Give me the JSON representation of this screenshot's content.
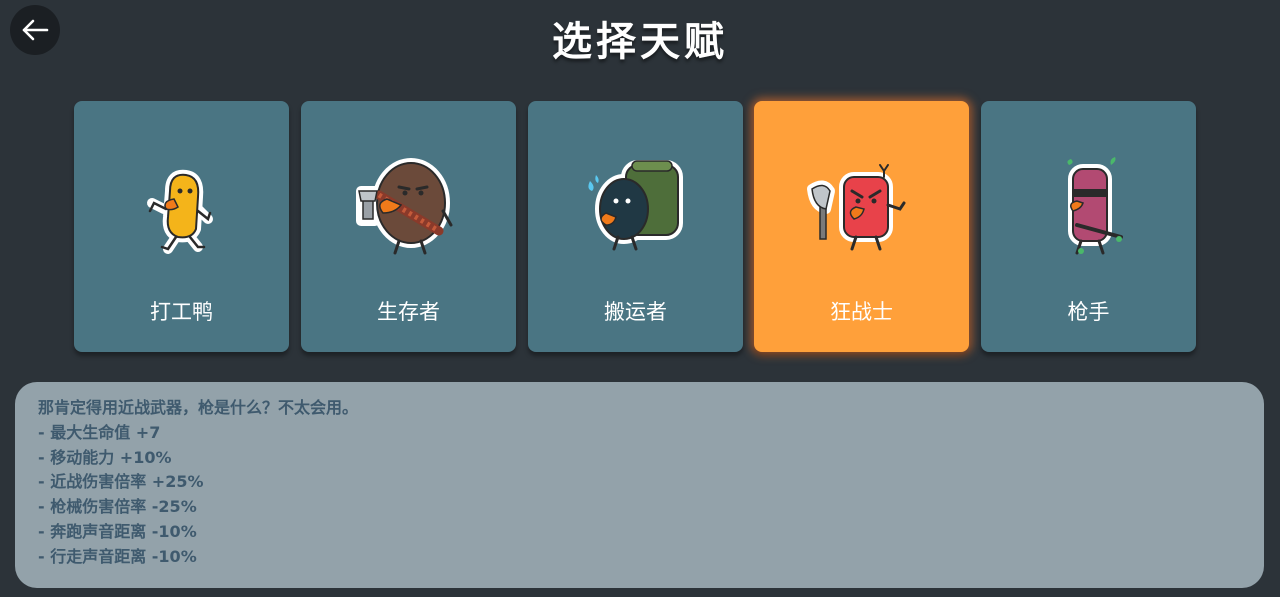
{
  "screen_title": "选择天赋",
  "back_button": {
    "icon": "arrow-left-icon"
  },
  "accent_colors": {
    "card_normal": "#4a7583",
    "card_selected": "#ffa03a",
    "background": "#2c3339",
    "description_panel": "#93a2aa",
    "description_text": "#3f5a6e"
  },
  "talents": [
    {
      "label": "打工鸭",
      "icon": "yellow-duck-character-icon",
      "selected": false
    },
    {
      "label": "生存者",
      "icon": "brown-survivor-character-icon",
      "selected": false
    },
    {
      "label": "搬运者",
      "icon": "backpack-carrier-character-icon",
      "selected": false
    },
    {
      "label": "狂战士",
      "icon": "red-berserker-axe-character-icon",
      "selected": true
    },
    {
      "label": "枪手",
      "icon": "purple-gunner-character-icon",
      "selected": false
    }
  ],
  "description": {
    "lines": [
      "那肯定得用近战武器，枪是什么？不太会用。",
      "- 最大生命值 +7",
      "- 移动能力 +10%",
      "- 近战伤害倍率 +25%",
      "- 枪械伤害倍率 -25%",
      "- 奔跑声音距离 -10%",
      "- 行走声音距离 -10%"
    ]
  }
}
